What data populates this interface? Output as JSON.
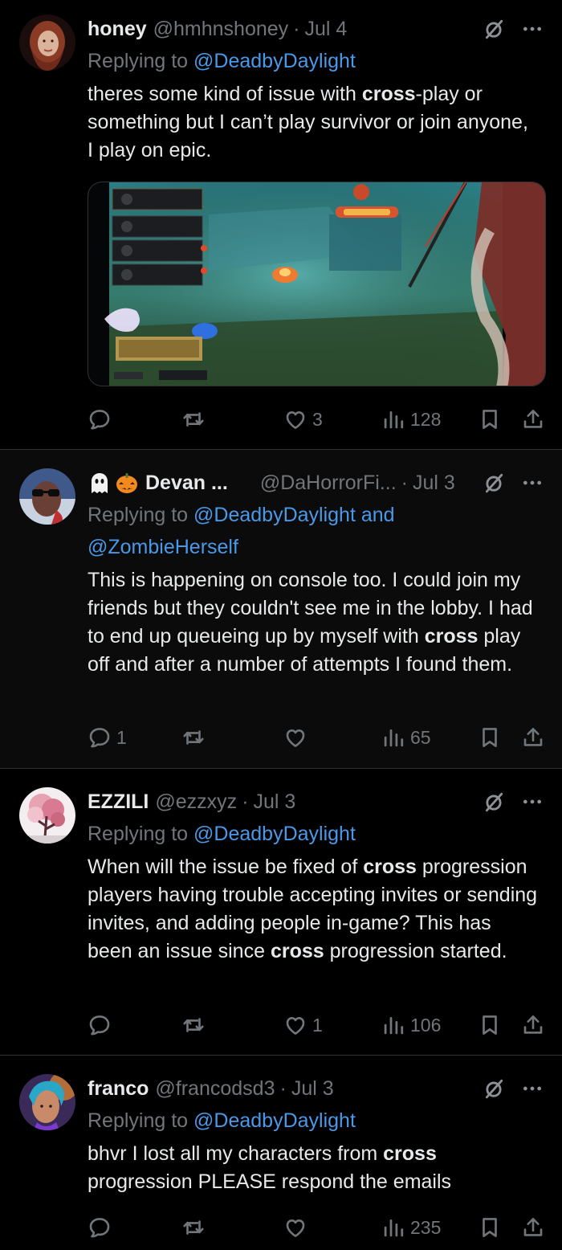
{
  "tweets": [
    {
      "name": "honey",
      "handle": "@hmhnshoney",
      "date": "Jul 4",
      "replying_prefix": "Replying to",
      "replying_line1": "@DeadbyDaylight",
      "replying_line2": "",
      "body": [
        {
          "t": "theres some kind of issue with ",
          "b": false
        },
        {
          "t": "cross",
          "b": true
        },
        {
          "t": "-play or something but I can’t play survivor or join anyone, I play on epic.",
          "b": false
        }
      ],
      "stats": {
        "replies": "",
        "retweets": "",
        "likes": "3",
        "views": "128"
      }
    },
    {
      "name": "Devan ...",
      "handle": "@DaHorrorFi...",
      "date": "Jul 3",
      "name_emojis": [
        "ghost-emoji",
        "jack-o-lantern-emoji"
      ],
      "replying_prefix": "Replying to",
      "replying_line1": "@DeadbyDaylight and",
      "replying_line2": "@ZombieHerself",
      "body": [
        {
          "t": "This is happening on console too. I could join my friends but they couldn't see me in the lobby. I had to end up queueing up by myself with ",
          "b": false
        },
        {
          "t": "cross",
          "b": true
        },
        {
          "t": " play off and after a number of attempts I found them.",
          "b": false
        }
      ],
      "stats": {
        "replies": "1",
        "retweets": "",
        "likes": "",
        "views": "65"
      }
    },
    {
      "name": "EZZILI",
      "handle": "@ezzxyz",
      "date": "Jul 3",
      "replying_prefix": "Replying to",
      "replying_line1": "@DeadbyDaylight",
      "replying_line2": "",
      "body": [
        {
          "t": "When will the issue be fixed of ",
          "b": false
        },
        {
          "t": "cross",
          "b": true
        },
        {
          "t": " progression players having trouble accepting invites or sending invites, and adding people in-game? This has been an issue since ",
          "b": false
        },
        {
          "t": "cross",
          "b": true
        },
        {
          "t": " progression started.",
          "b": false
        }
      ],
      "stats": {
        "replies": "",
        "retweets": "",
        "likes": "1",
        "views": "106"
      }
    },
    {
      "name": "franco",
      "handle": "@francodsd3",
      "date": "Jul 3",
      "replying_prefix": "Replying to",
      "replying_line1": "@DeadbyDaylight",
      "replying_line2": "",
      "body": [
        {
          "t": "bhvr I lost all my characters from ",
          "b": false
        },
        {
          "t": "cross",
          "b": true
        },
        {
          "t": " progression PLEASE respond the emails",
          "b": false
        }
      ],
      "stats": {
        "replies": "",
        "retweets": "",
        "likes": "",
        "views": "235"
      }
    }
  ],
  "icons": {
    "reply": "reply-icon",
    "retweet": "retweet-icon",
    "like": "like-icon",
    "views": "views-icon",
    "bookmark": "bookmark-icon",
    "share": "share-icon",
    "grok": "grok-icon",
    "more": "more-icon"
  },
  "colors": {
    "background": "#000000",
    "dim_background": "#0b0b0b",
    "text": "#e7e9ea",
    "secondary": "#71767b",
    "link": "#4a99e9",
    "divider": "#2f3336"
  }
}
